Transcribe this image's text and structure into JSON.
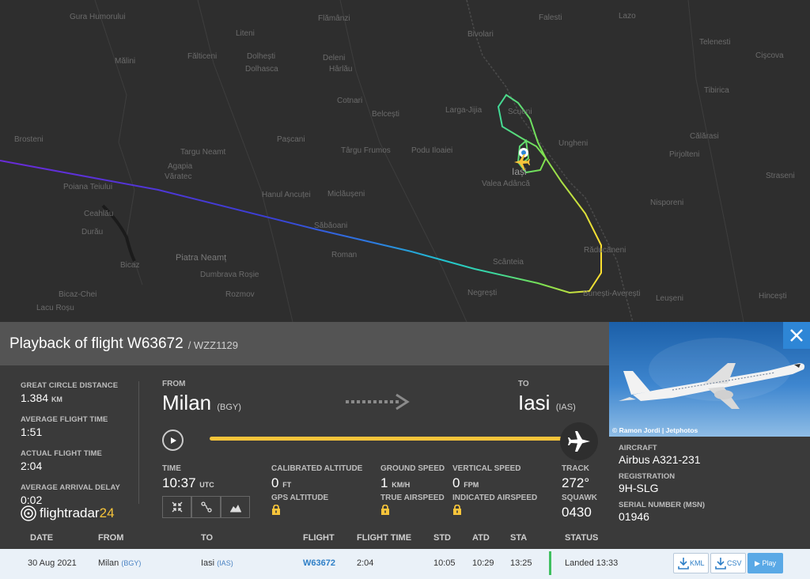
{
  "map": {
    "labels": [
      "Gura Humorului",
      "Fălticeni",
      "Mălini",
      "Liteni",
      "Dolhești",
      "Dolhasca",
      "Flămânzi",
      "Deleni",
      "Hârlău",
      "Falesti",
      "Lazo",
      "Telenesti",
      "Cişcova",
      "Bivolari",
      "Cotnari",
      "Belcești",
      "Larga-Jijia",
      "Scueni",
      "Tibirica",
      "Brosteni",
      "Targu Neamt",
      "Pașcani",
      "Târgu Frumos",
      "Podu Iloaiei",
      "Ungheni",
      "Călărasi",
      "Pirjolteni",
      "Straseni",
      "Agapia",
      "Văratec",
      "Iași",
      "Valea Adâncă",
      "Poiana Teiului",
      "Hanul Ancuței",
      "Miclăușeni",
      "Nisporeni",
      "Ceahlău",
      "Durău",
      "Săbăoani",
      "Răducăneni",
      "Bicaz",
      "Piatra Neamț",
      "Roman",
      "Scânteia",
      "Dumbrava Roșie",
      "Bicaz-Chei",
      "Rozmov",
      "Negrești",
      "Bunești-Averești",
      "Leușeni",
      "Hincești",
      "Lacu Roșu"
    ]
  },
  "panel": {
    "title": "Playback of flight W63672",
    "subtitle": "/ WZZ1129",
    "stats": [
      {
        "label": "GREAT CIRCLE DISTANCE",
        "value": "1.384",
        "unit": "KM"
      },
      {
        "label": "AVERAGE FLIGHT TIME",
        "value": "1:51",
        "unit": ""
      },
      {
        "label": "ACTUAL FLIGHT TIME",
        "value": "2:04",
        "unit": ""
      },
      {
        "label": "AVERAGE ARRIVAL DELAY",
        "value": "0:02",
        "unit": ""
      }
    ],
    "logo_main": "flightradar",
    "logo_num": "24",
    "from_label": "FROM",
    "from_city": "Milan",
    "from_code": "(BGY)",
    "to_label": "TO",
    "to_city": "Iasi",
    "to_code": "(IAS)",
    "progress": 1.0,
    "time_label": "TIME",
    "time_value": "10:37",
    "time_unit": "UTC",
    "cal_alt_label": "CALIBRATED ALTITUDE",
    "cal_alt_value": "0",
    "cal_alt_unit": "FT",
    "gps_alt_label": "GPS ALTITUDE",
    "ground_speed_label": "GROUND SPEED",
    "ground_speed_value": "1",
    "ground_speed_unit": "KM/H",
    "true_airspeed_label": "TRUE AIRSPEED",
    "vertical_speed_label": "VERTICAL SPEED",
    "vertical_speed_value": "0",
    "vertical_speed_unit": "FPM",
    "indicated_airspeed_label": "INDICATED AIRSPEED",
    "track_label": "TRACK",
    "track_value": "272°",
    "squawk_label": "SQUAWK",
    "squawk_value": "0430"
  },
  "aircraft": {
    "photo_credit": "© Ramon Jordi | Jetphotos",
    "type_label": "AIRCRAFT",
    "type_value": "Airbus A321-231",
    "reg_label": "REGISTRATION",
    "reg_value": "9H-SLG",
    "msn_label": "SERIAL NUMBER (MSN)",
    "msn_value": "01946"
  },
  "table": {
    "headers": [
      "DATE",
      "FROM",
      "TO",
      "FLIGHT",
      "FLIGHT TIME",
      "STD",
      "ATD",
      "STA",
      "STATUS"
    ],
    "row": {
      "date": "30 Aug 2021",
      "from": "Milan",
      "from_code": "(BGY)",
      "to": "Iasi",
      "to_code": "(IAS)",
      "flight": "W63672",
      "flight_time": "2:04",
      "std": "10:05",
      "atd": "10:29",
      "sta": "13:25",
      "status": "Landed 13:33",
      "kml_label": "KML",
      "csv_label": "CSV",
      "play_label": "▶ Play"
    }
  },
  "colors": {
    "accent_yellow": "#f7c43a",
    "accent_blue": "#2e86d6",
    "status_green": "#3fbf5f"
  }
}
